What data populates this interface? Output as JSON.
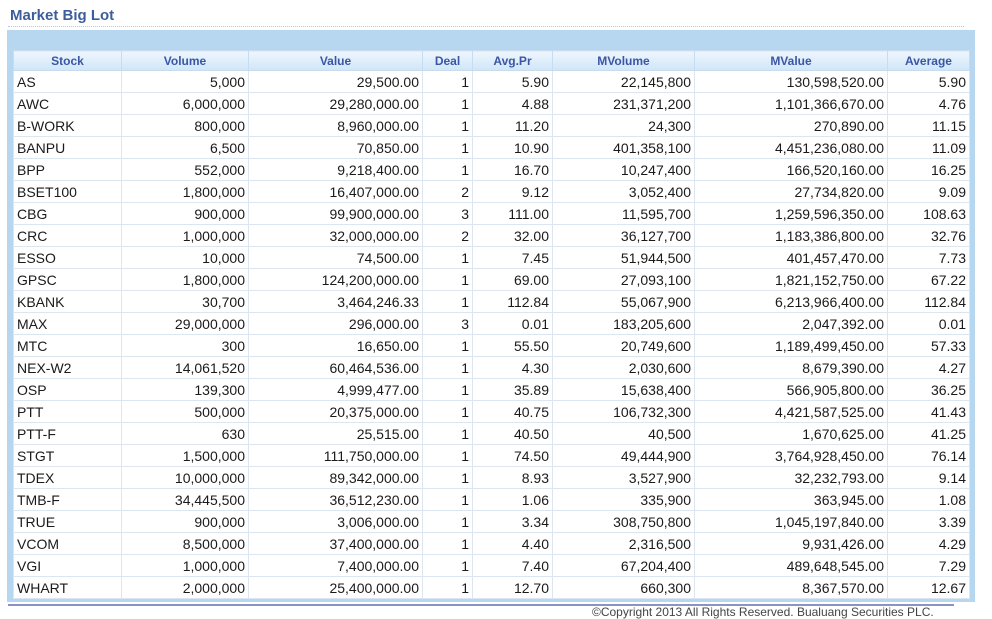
{
  "title": "Market Big Lot",
  "columns": [
    "Stock",
    "Volume",
    "Value",
    "Deal",
    "Avg.Pr",
    "MVolume",
    "MValue",
    "Average"
  ],
  "rows": [
    [
      "AS",
      "5,000",
      "29,500.00",
      "1",
      "5.90",
      "22,145,800",
      "130,598,520.00",
      "5.90"
    ],
    [
      "AWC",
      "6,000,000",
      "29,280,000.00",
      "1",
      "4.88",
      "231,371,200",
      "1,101,366,670.00",
      "4.76"
    ],
    [
      "B-WORK",
      "800,000",
      "8,960,000.00",
      "1",
      "11.20",
      "24,300",
      "270,890.00",
      "11.15"
    ],
    [
      "BANPU",
      "6,500",
      "70,850.00",
      "1",
      "10.90",
      "401,358,100",
      "4,451,236,080.00",
      "11.09"
    ],
    [
      "BPP",
      "552,000",
      "9,218,400.00",
      "1",
      "16.70",
      "10,247,400",
      "166,520,160.00",
      "16.25"
    ],
    [
      "BSET100",
      "1,800,000",
      "16,407,000.00",
      "2",
      "9.12",
      "3,052,400",
      "27,734,820.00",
      "9.09"
    ],
    [
      "CBG",
      "900,000",
      "99,900,000.00",
      "3",
      "111.00",
      "11,595,700",
      "1,259,596,350.00",
      "108.63"
    ],
    [
      "CRC",
      "1,000,000",
      "32,000,000.00",
      "2",
      "32.00",
      "36,127,700",
      "1,183,386,800.00",
      "32.76"
    ],
    [
      "ESSO",
      "10,000",
      "74,500.00",
      "1",
      "7.45",
      "51,944,500",
      "401,457,470.00",
      "7.73"
    ],
    [
      "GPSC",
      "1,800,000",
      "124,200,000.00",
      "1",
      "69.00",
      "27,093,100",
      "1,821,152,750.00",
      "67.22"
    ],
    [
      "KBANK",
      "30,700",
      "3,464,246.33",
      "1",
      "112.84",
      "55,067,900",
      "6,213,966,400.00",
      "112.84"
    ],
    [
      "MAX",
      "29,000,000",
      "296,000.00",
      "3",
      "0.01",
      "183,205,600",
      "2,047,392.00",
      "0.01"
    ],
    [
      "MTC",
      "300",
      "16,650.00",
      "1",
      "55.50",
      "20,749,600",
      "1,189,499,450.00",
      "57.33"
    ],
    [
      "NEX-W2",
      "14,061,520",
      "60,464,536.00",
      "1",
      "4.30",
      "2,030,600",
      "8,679,390.00",
      "4.27"
    ],
    [
      "OSP",
      "139,300",
      "4,999,477.00",
      "1",
      "35.89",
      "15,638,400",
      "566,905,800.00",
      "36.25"
    ],
    [
      "PTT",
      "500,000",
      "20,375,000.00",
      "1",
      "40.75",
      "106,732,300",
      "4,421,587,525.00",
      "41.43"
    ],
    [
      "PTT-F",
      "630",
      "25,515.00",
      "1",
      "40.50",
      "40,500",
      "1,670,625.00",
      "41.25"
    ],
    [
      "STGT",
      "1,500,000",
      "111,750,000.00",
      "1",
      "74.50",
      "49,444,900",
      "3,764,928,450.00",
      "76.14"
    ],
    [
      "TDEX",
      "10,000,000",
      "89,342,000.00",
      "1",
      "8.93",
      "3,527,900",
      "32,232,793.00",
      "9.14"
    ],
    [
      "TMB-F",
      "34,445,500",
      "36,512,230.00",
      "1",
      "1.06",
      "335,900",
      "363,945.00",
      "1.08"
    ],
    [
      "TRUE",
      "900,000",
      "3,006,000.00",
      "1",
      "3.34",
      "308,750,800",
      "1,045,197,840.00",
      "3.39"
    ],
    [
      "VCOM",
      "8,500,000",
      "37,400,000.00",
      "1",
      "4.40",
      "2,316,500",
      "9,931,426.00",
      "4.29"
    ],
    [
      "VGI",
      "1,000,000",
      "7,400,000.00",
      "1",
      "7.40",
      "67,204,400",
      "489,648,545.00",
      "7.29"
    ],
    [
      "WHART",
      "2,000,000",
      "25,400,000.00",
      "1",
      "12.70",
      "660,300",
      "8,367,570.00",
      "12.67"
    ]
  ],
  "footer": "©Copyright 2013 All Rights Reserved. Bualuang Securities PLC."
}
